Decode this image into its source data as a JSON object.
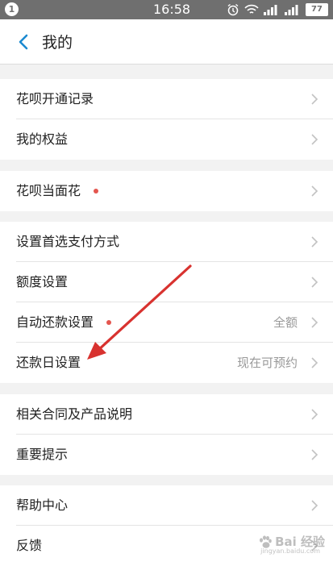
{
  "status_bar": {
    "notification_count": "1",
    "time": "16:58",
    "battery_level": "77",
    "icons": [
      "alarm-icon",
      "wifi-icon",
      "signal-icon",
      "signal-icon",
      "battery-icon"
    ]
  },
  "nav": {
    "title": "我的",
    "back_icon": "chevron-left-icon"
  },
  "sections": [
    {
      "items": [
        {
          "label": "花呗开通记录"
        },
        {
          "label": "我的权益"
        }
      ]
    },
    {
      "items": [
        {
          "label": "花呗当面花",
          "red_dot": true
        }
      ]
    },
    {
      "items": [
        {
          "label": "设置首选支付方式"
        },
        {
          "label": "额度设置"
        },
        {
          "label": "自动还款设置",
          "red_dot": true,
          "value": "全额"
        },
        {
          "label": "还款日设置",
          "value": "现在可预约"
        }
      ]
    },
    {
      "items": [
        {
          "label": "相关合同及产品说明"
        },
        {
          "label": "重要提示"
        }
      ]
    },
    {
      "items": [
        {
          "label": "帮助中心"
        },
        {
          "label": "反馈"
        }
      ]
    }
  ],
  "colors": {
    "accent": "#1b8ad0",
    "red_dot": "#e4564f",
    "annotation_arrow": "#d8322f",
    "status_bar": "#6f6f6f"
  },
  "watermark": {
    "text": "Bai 经验",
    "sub": "jingyan.baidu.com"
  }
}
